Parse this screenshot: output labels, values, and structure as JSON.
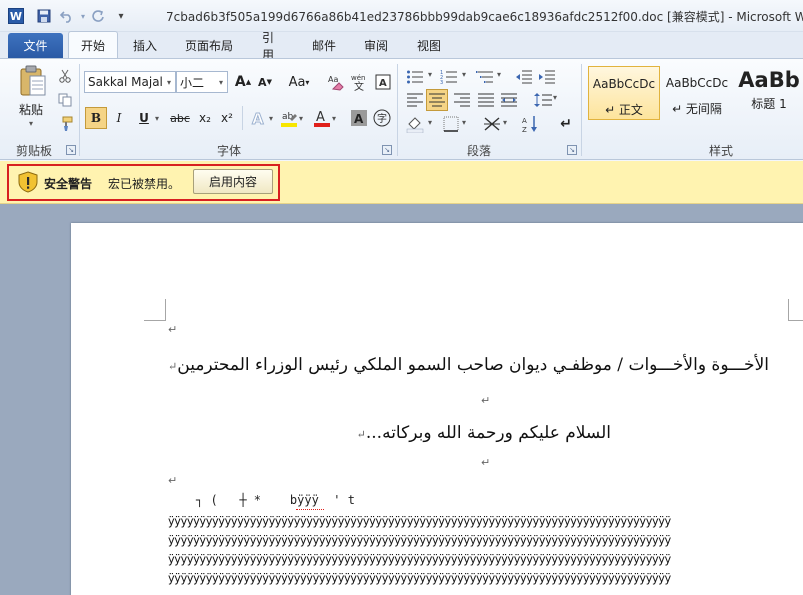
{
  "window": {
    "title": "7cbad6b3f505a199d6766a86b41ed23786bbb99dab9cae6c18936afdc2512f00.doc [兼容模式] - Microsoft Word"
  },
  "quick_access": {
    "app_icon_letter": "W",
    "save_icon": "save-icon",
    "undo_icon": "undo-icon",
    "redo_icon": "redo-icon",
    "customize_icon": "customize-icon"
  },
  "tabs": [
    {
      "label": "文件"
    },
    {
      "label": "开始"
    },
    {
      "label": "插入"
    },
    {
      "label": "页面布局"
    },
    {
      "label": "引用"
    },
    {
      "label": "邮件"
    },
    {
      "label": "审阅"
    },
    {
      "label": "视图"
    }
  ],
  "clipboard": {
    "paste_label": "粘贴",
    "group_label": "剪贴板"
  },
  "font": {
    "font_name": "Sakkal Majal",
    "font_size": "小二",
    "group_label": "字体",
    "bold": "B",
    "italic": "I",
    "underline": "U",
    "strike": "abc",
    "sub": "x₂",
    "sup": "x²",
    "change_case": "Aa",
    "grow": "A",
    "shrink": "A",
    "highlight_color": "#f7e600",
    "font_color": "#e0201b"
  },
  "paragraph": {
    "group_label": "段落"
  },
  "styles": {
    "group_label": "样式",
    "items": [
      {
        "sample": "AaBbCcDc",
        "name": "↵ 正文"
      },
      {
        "sample": "AaBbCcDc",
        "name": "↵ 无间隔"
      },
      {
        "sample": "AaBb",
        "name": "标题 1"
      }
    ]
  },
  "security": {
    "title": "安全警告",
    "message": "宏已被禁用。",
    "enable_button": "启用内容"
  },
  "document": {
    "line1": "الأخـــوة والأخـــوات / موظفـي ديوان صاحب السمو الملكي رئيس الوزراء المحترمين",
    "line2": "السلام عليكم ورحمة الله وبركاته...",
    "garbled": "┐ (   ┼ *    bÿÿÿ  ' t",
    "yrow": "ÿÿÿÿÿÿÿÿÿÿÿÿÿÿÿÿÿÿÿÿÿÿÿÿÿÿÿÿÿÿÿÿÿÿÿÿÿÿÿÿÿÿÿÿÿÿÿÿÿÿÿÿÿÿÿÿÿÿÿÿÿÿÿÿÿÿÿÿÿÿÿÿÿÿÿÿÿÿÿÿ",
    "para_mark": "↵"
  }
}
